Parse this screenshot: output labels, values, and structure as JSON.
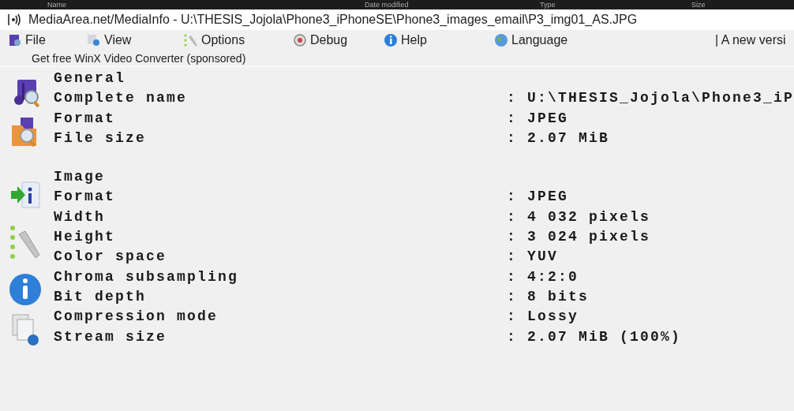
{
  "explorer_header": {
    "columns": [
      "Name",
      "Date modified",
      "Type",
      "Size"
    ]
  },
  "window": {
    "title": "MediaArea.net/MediaInfo - U:\\THESIS_Jojola\\Phone3_iPhoneSE\\Phone3_images_email\\P3_img01_AS.JPG"
  },
  "menu": [
    {
      "label": "File"
    },
    {
      "label": "View"
    },
    {
      "label": "Options"
    },
    {
      "label": "Debug"
    },
    {
      "label": "Help"
    },
    {
      "label": "Language"
    }
  ],
  "update_notice": "| A new versi",
  "sponsored_link": "Get free WinX Video Converter (sponsored)",
  "sections": [
    {
      "title": "General",
      "fields": [
        {
          "label": "Complete name",
          "value": ": U:\\THESIS_Jojola\\Phone3_iP"
        },
        {
          "label": "Format",
          "value": ": JPEG"
        },
        {
          "label": "File size",
          "value": ": 2.07 MiB"
        }
      ]
    },
    {
      "title": "Image",
      "fields": [
        {
          "label": "Format",
          "value": ": JPEG"
        },
        {
          "label": "Width",
          "value": ": 4 032 pixels"
        },
        {
          "label": "Height",
          "value": ": 3 024 pixels"
        },
        {
          "label": "Color space",
          "value": ": YUV"
        },
        {
          "label": "Chroma subsampling",
          "value": ": 4:2:0"
        },
        {
          "label": "Bit depth",
          "value": ": 8 bits"
        },
        {
          "label": "Compression mode",
          "value": ": Lossy"
        },
        {
          "label": "Stream size",
          "value": ": 2.07 MiB (100%)"
        }
      ]
    }
  ]
}
